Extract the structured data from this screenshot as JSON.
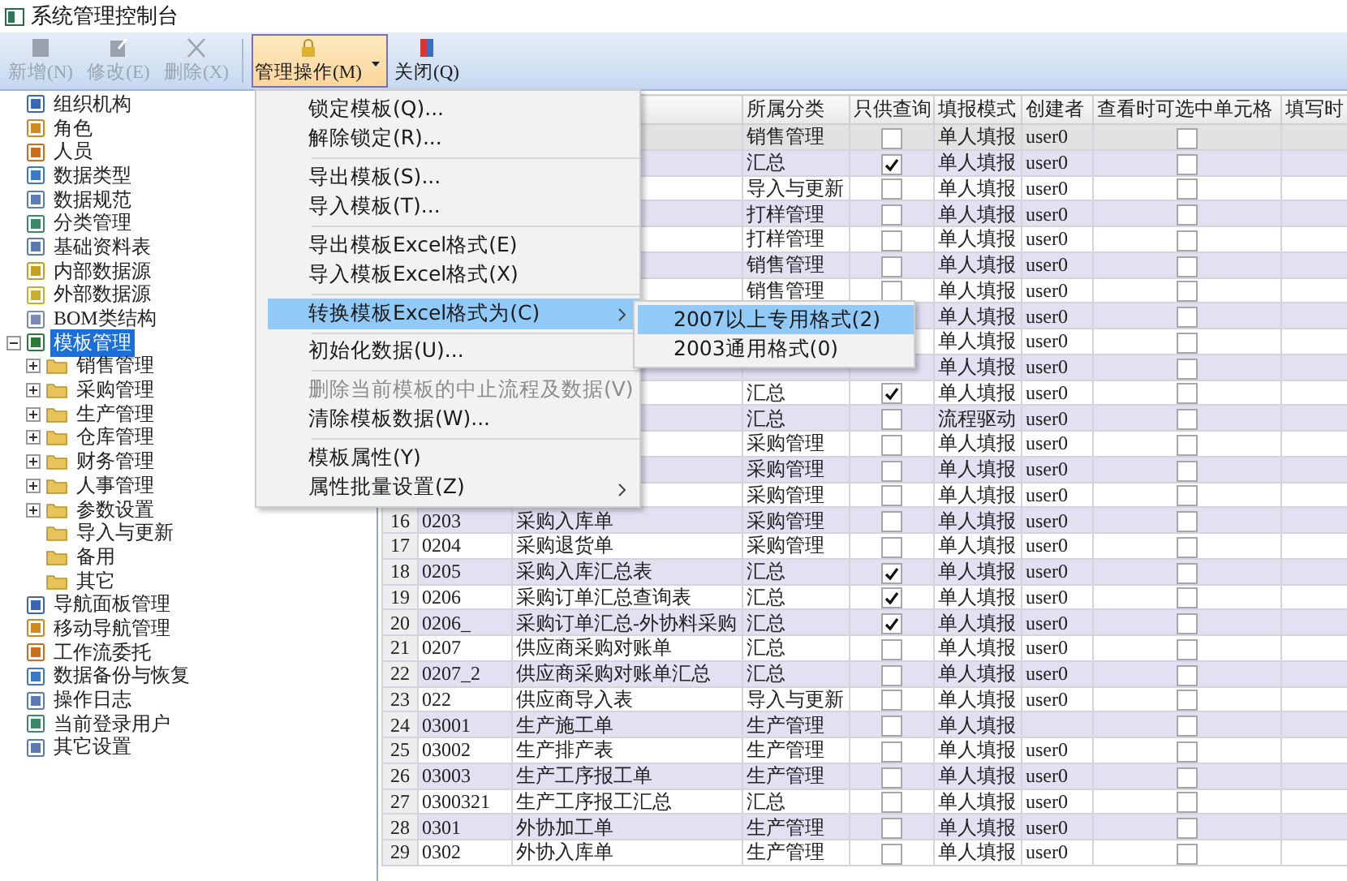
{
  "window": {
    "title": "系统管理控制台"
  },
  "toolbar": [
    {
      "label": "新增(N)",
      "kind": "button",
      "disabled": true,
      "pressed": false
    },
    {
      "label": "修改(E)",
      "kind": "button",
      "disabled": true,
      "pressed": false
    },
    {
      "label": "删除(X)",
      "kind": "button",
      "disabled": true,
      "pressed": false
    },
    {
      "label": "管理操作(M)",
      "kind": "dropdown",
      "disabled": false,
      "pressed": true
    },
    {
      "label": "关闭(Q)",
      "kind": "button",
      "disabled": false,
      "pressed": false
    }
  ],
  "tree": [
    {
      "label": "组织机构",
      "selected": false
    },
    {
      "label": "角色",
      "selected": false
    },
    {
      "label": "人员",
      "selected": false
    },
    {
      "label": "数据类型",
      "selected": false
    },
    {
      "label": "数据规范",
      "selected": false
    },
    {
      "label": "分类管理",
      "selected": false
    },
    {
      "label": "基础资料表",
      "selected": false
    },
    {
      "label": "内部数据源",
      "selected": false
    },
    {
      "label": "外部数据源",
      "selected": false
    },
    {
      "label": "BOM类结构",
      "selected": false
    },
    {
      "label": "模板管理",
      "selected": true,
      "expanded": true,
      "children": [
        {
          "label": "销售管理",
          "selected": false,
          "expanded": false
        },
        {
          "label": "采购管理",
          "selected": false,
          "expanded": false
        },
        {
          "label": "生产管理",
          "selected": false,
          "expanded": false
        },
        {
          "label": "仓库管理",
          "selected": false,
          "expanded": false
        },
        {
          "label": "财务管理",
          "selected": false,
          "expanded": false
        },
        {
          "label": "人事管理",
          "selected": false,
          "expanded": false
        },
        {
          "label": "参数设置",
          "selected": false,
          "expanded": false
        },
        {
          "label": "导入与更新",
          "selected": false
        },
        {
          "label": "备用",
          "selected": false
        },
        {
          "label": "其它",
          "selected": false
        }
      ]
    },
    {
      "label": "导航面板管理",
      "selected": false
    },
    {
      "label": "移动导航管理",
      "selected": false
    },
    {
      "label": "工作流委托",
      "selected": false
    },
    {
      "label": "数据备份与恢复",
      "selected": false
    },
    {
      "label": "操作日志",
      "selected": false
    },
    {
      "label": "当前登录用户",
      "selected": false
    },
    {
      "label": "其它设置",
      "selected": false
    }
  ],
  "table": {
    "columns": [
      "所属分类",
      "只供查询",
      "填报模式",
      "创建者",
      "查看时可选中单元格",
      "填写时"
    ],
    "rows": [
      {
        "selected": true,
        "category": "销售管理",
        "query_only": false,
        "mode": "单人填报",
        "creator": "user0",
        "selectable": false
      },
      {
        "selected": false,
        "category": "汇总",
        "query_only": true,
        "mode": "单人填报",
        "creator": "user0",
        "selectable": false
      },
      {
        "selected": false,
        "category": "导入与更新",
        "query_only": false,
        "mode": "单人填报",
        "creator": "user0",
        "selectable": false
      },
      {
        "selected": false,
        "category": "打样管理",
        "query_only": false,
        "mode": "单人填报",
        "creator": "user0",
        "selectable": false
      },
      {
        "selected": false,
        "category": "打样管理",
        "query_only": false,
        "mode": "单人填报",
        "creator": "user0",
        "selectable": false
      },
      {
        "selected": false,
        "category": "销售管理",
        "query_only": false,
        "mode": "单人填报",
        "creator": "user0",
        "selectable": false
      },
      {
        "selected": false,
        "category": "销售管理",
        "query_only": false,
        "mode": "单人填报",
        "creator": "user0",
        "selectable": false
      },
      {
        "selected": false,
        "mode": "单人填报",
        "creator": "user0",
        "selectable": false
      },
      {
        "selected": false,
        "mode": "单人填报",
        "creator": "user0",
        "selectable": false
      },
      {
        "selected": false,
        "mode": "单人填报",
        "creator": "user0",
        "selectable": false
      },
      {
        "selected": false,
        "category": "汇总",
        "query_only": true,
        "mode": "单人填报",
        "creator": "user0",
        "selectable": false
      },
      {
        "selected": false,
        "category": "汇总",
        "query_only": false,
        "mode": "流程驱动",
        "creator": "user0",
        "selectable": false
      },
      {
        "selected": false,
        "category": "采购管理",
        "query_only": false,
        "mode": "单人填报",
        "creator": "user0",
        "selectable": false
      },
      {
        "selected": false,
        "category": "采购管理",
        "query_only": false,
        "mode": "单人填报",
        "creator": "user0",
        "selectable": false
      },
      {
        "selected": false,
        "category": "采购管理",
        "query_only": false,
        "mode": "单人填报",
        "creator": "user0",
        "selectable": false
      },
      {
        "selected": false,
        "number": "16",
        "code": "0203",
        "name": "采购入库单",
        "category": "采购管理",
        "query_only": false,
        "mode": "单人填报",
        "creator": "user0",
        "selectable": false
      },
      {
        "selected": false,
        "number": "17",
        "code": "0204",
        "name": "采购退货单",
        "category": "采购管理",
        "query_only": false,
        "mode": "单人填报",
        "creator": "user0",
        "selectable": false
      },
      {
        "selected": false,
        "number": "18",
        "code": "0205",
        "name": "采购入库汇总表",
        "category": "汇总",
        "query_only": true,
        "mode": "单人填报",
        "creator": "user0",
        "selectable": false
      },
      {
        "selected": false,
        "number": "19",
        "code": "0206",
        "name": "采购订单汇总查询表",
        "category": "汇总",
        "query_only": true,
        "mode": "单人填报",
        "creator": "user0",
        "selectable": false
      },
      {
        "selected": false,
        "number": "20",
        "code": "0206_",
        "name": "采购订单汇总-外协料采购",
        "category": "汇总",
        "query_only": true,
        "mode": "单人填报",
        "creator": "user0",
        "selectable": false
      },
      {
        "selected": false,
        "number": "21",
        "code": "0207",
        "name": "供应商采购对账单",
        "category": "汇总",
        "query_only": false,
        "mode": "单人填报",
        "creator": "user0",
        "selectable": false
      },
      {
        "selected": false,
        "number": "22",
        "code": "0207_2",
        "name": "供应商采购对账单汇总",
        "category": "汇总",
        "query_only": false,
        "mode": "单人填报",
        "creator": "user0",
        "selectable": false
      },
      {
        "selected": false,
        "number": "23",
        "code": "022",
        "name": "供应商导入表",
        "category": "导入与更新",
        "query_only": false,
        "mode": "单人填报",
        "creator": "user0",
        "selectable": false
      },
      {
        "selected": false,
        "number": "24",
        "code": "03001",
        "name": "生产施工单",
        "category": "生产管理",
        "query_only": false,
        "mode": "单人填报",
        "selectable": false
      },
      {
        "selected": false,
        "number": "25",
        "code": "03002",
        "name": "生产排产表",
        "category": "生产管理",
        "query_only": false,
        "mode": "单人填报",
        "creator": "user0",
        "selectable": false
      },
      {
        "selected": false,
        "number": "26",
        "code": "03003",
        "name": "生产工序报工单",
        "category": "生产管理",
        "query_only": false,
        "mode": "单人填报",
        "creator": "user0",
        "selectable": false
      },
      {
        "selected": false,
        "number": "27",
        "code": "0300321",
        "name": "生产工序报工汇总",
        "category": "汇总",
        "query_only": false,
        "mode": "单人填报",
        "creator": "user0",
        "selectable": false
      },
      {
        "selected": false,
        "number": "28",
        "code": "0301",
        "name": "外协加工单",
        "category": "生产管理",
        "query_only": false,
        "mode": "单人填报",
        "creator": "user0",
        "selectable": false
      },
      {
        "selected": false,
        "number": "29",
        "code": "0302",
        "name": "外协入库单",
        "category": "生产管理",
        "query_only": false,
        "mode": "单人填报",
        "creator": "user0",
        "selectable": false
      }
    ]
  },
  "menu": {
    "items": [
      {
        "kind": "item",
        "label": "锁定模板(Q)...",
        "selected": false,
        "disabled": false,
        "has_submenu": false
      },
      {
        "kind": "item",
        "label": "解除锁定(R)...",
        "selected": false,
        "disabled": false,
        "has_submenu": false
      },
      {
        "kind": "separator"
      },
      {
        "kind": "item",
        "label": "导出模板(S)...",
        "selected": false,
        "disabled": false,
        "has_submenu": false
      },
      {
        "kind": "item",
        "label": "导入模板(T)...",
        "selected": false,
        "disabled": false,
        "has_submenu": false
      },
      {
        "kind": "separator"
      },
      {
        "kind": "item",
        "label": "导出模板Excel格式(E)",
        "selected": false,
        "disabled": false,
        "has_submenu": false
      },
      {
        "kind": "item",
        "label": "导入模板Excel格式(X)",
        "selected": false,
        "disabled": false,
        "has_submenu": false
      },
      {
        "kind": "separator"
      },
      {
        "kind": "item",
        "label": "转换模板Excel格式为(C)",
        "selected": true,
        "disabled": false,
        "has_submenu": true,
        "submenu": [
          {
            "label": "2007以上专用格式(2)",
            "selected": true
          },
          {
            "label": "2003通用格式(0)",
            "selected": false
          }
        ]
      },
      {
        "kind": "separator"
      },
      {
        "kind": "item",
        "label": "初始化数据(U)...",
        "selected": false,
        "disabled": false,
        "has_submenu": false
      },
      {
        "kind": "separator"
      },
      {
        "kind": "item",
        "label": "删除当前模板的中止流程及数据(V)",
        "selected": false,
        "disabled": true,
        "has_submenu": false
      },
      {
        "kind": "item",
        "label": "清除模板数据(W)...",
        "selected": false,
        "disabled": false,
        "has_submenu": false
      },
      {
        "kind": "separator"
      },
      {
        "kind": "item",
        "label": "模板属性(Y)",
        "selected": false,
        "disabled": false,
        "has_submenu": false
      },
      {
        "kind": "item",
        "label": "属性批量设置(Z)",
        "selected": false,
        "disabled": false,
        "has_submenu": true
      }
    ]
  }
}
